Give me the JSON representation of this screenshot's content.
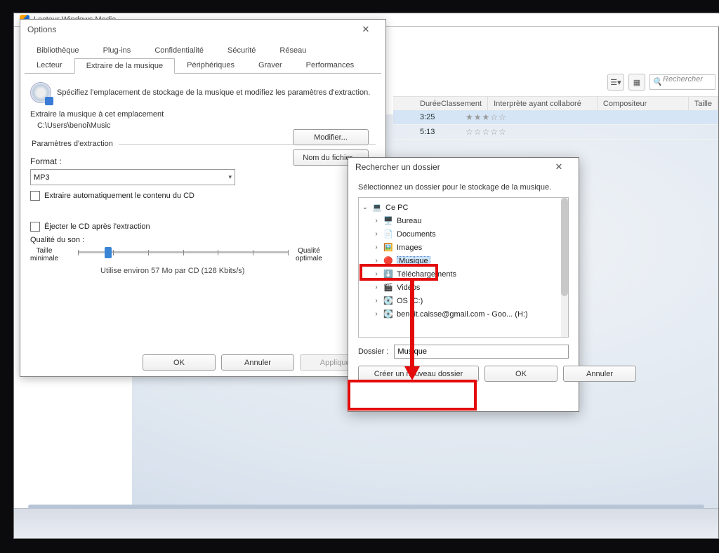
{
  "app": {
    "title": "Lecteur Windows Media"
  },
  "toolbar": {
    "search_placeholder": "Rechercher"
  },
  "columns": {
    "duree": "Durée",
    "classement": "Classement",
    "interprete": "Interprète ayant collaboré",
    "compositeur": "Compositeur",
    "taille": "Taille"
  },
  "tracks": [
    {
      "duration": "3:25",
      "stars": "★★★☆☆"
    },
    {
      "duration": "5:13",
      "stars": "☆☆☆☆☆"
    }
  ],
  "options": {
    "title": "Options",
    "tabs_row1": [
      "Bibliothèque",
      "Plug-ins",
      "Confidentialité",
      "Sécurité",
      "Réseau"
    ],
    "tabs_row2": [
      "Lecteur",
      "Extraire de la musique",
      "Périphériques",
      "Graver",
      "Performances"
    ],
    "active_tab": "Extraire de la musique",
    "info": "Spécifiez l'emplacement de stockage de la musique et modifiez les paramètres d'extraction.",
    "section_location": "Extraire la musique à cet emplacement",
    "path": "C:\\Users\\benoi\\Music",
    "change_btn": "Modifier...",
    "filename_btn": "Nom du fichier...",
    "section_params": "Paramètres d'extraction",
    "format_lbl": "Format :",
    "format_value": "MP3",
    "chk_auto": "Extraire automatiquement le contenu du CD",
    "chk_eject": "Éjecter le CD après l'extraction",
    "quality_lbl": "Qualité du son :",
    "quality_min": "Taille\nminimale",
    "quality_max": "Qualité\noptimale",
    "size_note": "Utilise environ 57 Mo par CD (128 Kbits/s)",
    "ok": "OK",
    "cancel": "Annuler",
    "apply": "Appliquer"
  },
  "browse": {
    "title": "Rechercher un dossier",
    "desc": "Sélectionnez un dossier pour le stockage de la musique.",
    "root": "Ce PC",
    "nodes": [
      {
        "label": "Bureau",
        "icon": "🖥️"
      },
      {
        "label": "Documents",
        "icon": "📄"
      },
      {
        "label": "Images",
        "icon": "🖼️"
      },
      {
        "label": "Musique",
        "icon": "🔴",
        "selected": true
      },
      {
        "label": "Téléchargements",
        "icon": "⬇️"
      },
      {
        "label": "Vidéos",
        "icon": "🎬"
      },
      {
        "label": "OS (C:)",
        "icon": "💽"
      },
      {
        "label": "benoit.caisse@gmail.com - Goo... (H:)",
        "icon": "💽"
      }
    ],
    "folder_lbl": "Dossier :",
    "folder_value": "Musique",
    "new_folder": "Créer un nouveau dossier",
    "ok": "OK",
    "cancel": "Annuler"
  }
}
